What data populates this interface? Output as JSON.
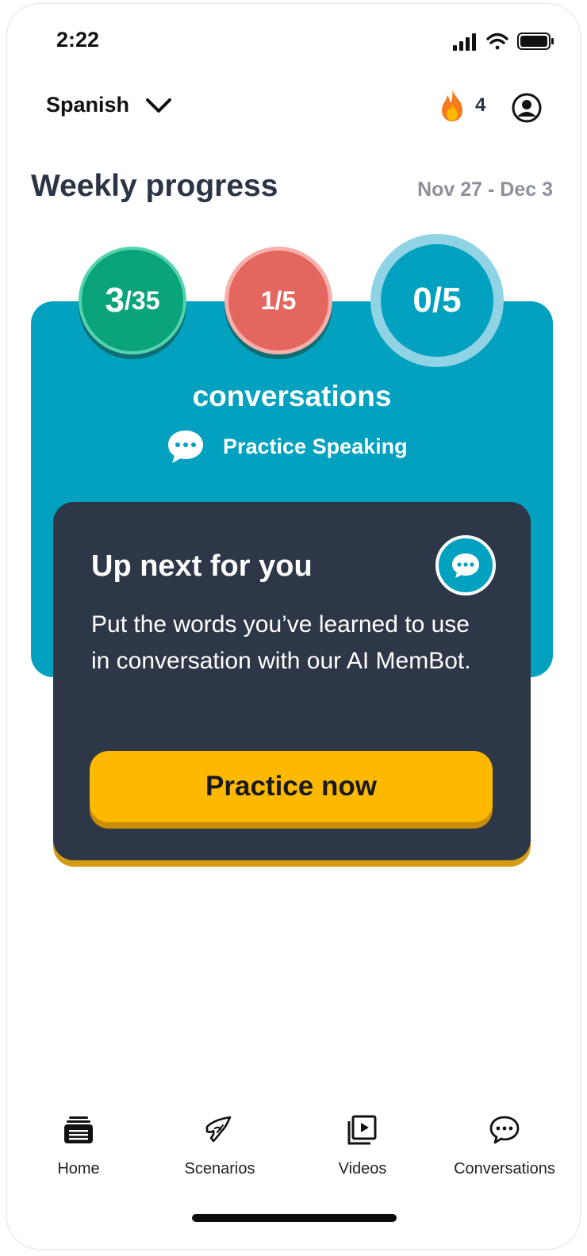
{
  "status_bar": {
    "time": "2:22",
    "icons": [
      "signal-icon",
      "wifi-icon",
      "battery-icon"
    ]
  },
  "header": {
    "language": "Spanish",
    "streak_count": "4",
    "icons": {
      "chevron": "chevron-down-icon",
      "streak": "flame-icon",
      "profile": "profile-icon"
    }
  },
  "weekly": {
    "title": "Weekly progress",
    "date_range": "Nov 27 - Dec 3",
    "goals": [
      {
        "value": "3",
        "target": "/35",
        "color": "#0aa37a"
      },
      {
        "value": "1/5",
        "color": "#e4675f"
      },
      {
        "value": "0/5",
        "color": "#01a1bf"
      }
    ],
    "label": "conversations",
    "practice_label": "Practice Speaking"
  },
  "card": {
    "title": "Up next for you",
    "text": "Put the words you’ve learned to use in conversation with our AI MemBot.",
    "button": "Practice now",
    "button_color": "#fdb800",
    "icon": "chat-bubble-icon"
  },
  "nav": {
    "items": [
      {
        "label": "Home",
        "icon": "home-stack-icon"
      },
      {
        "label": "Scenarios",
        "icon": "scenario-hand-icon"
      },
      {
        "label": "Videos",
        "icon": "video-play-icon"
      },
      {
        "label": "Conversations",
        "icon": "chat-icon"
      }
    ]
  },
  "colors": {
    "accent": "#01a1bf",
    "card": "#2d3748",
    "text_dark": "#2b3445"
  }
}
